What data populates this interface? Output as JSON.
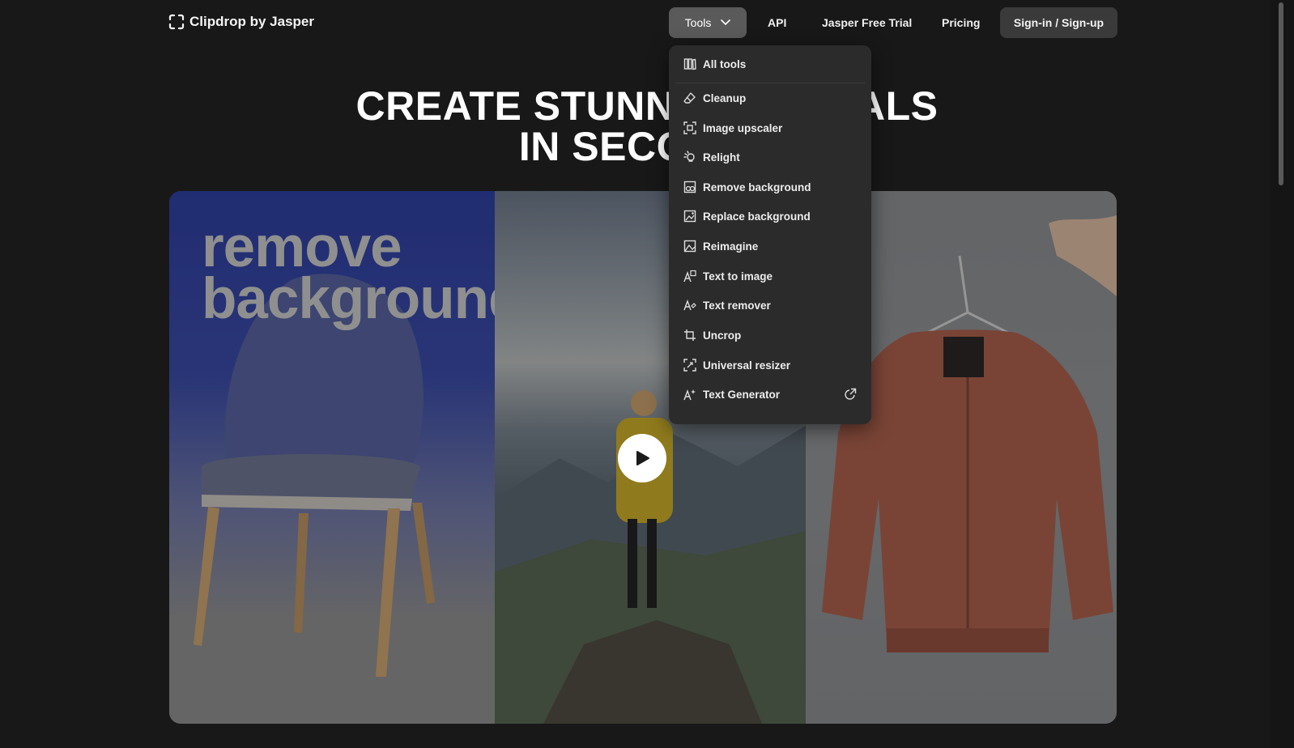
{
  "header": {
    "logo_text": "Clipdrop by Jasper",
    "nav": {
      "tools_label": "Tools",
      "api_label": "API",
      "trial_label": "Jasper Free Trial",
      "pricing_label": "Pricing",
      "signin_label": "Sign-in / Sign-up"
    }
  },
  "hero": {
    "title_line1": "CREATE STUNNING VISUALS",
    "title_line2": "IN SECONDS"
  },
  "banner": {
    "text_line1": "remove",
    "text_line2": "background"
  },
  "tools_menu": {
    "items": [
      {
        "label": "All tools",
        "icon": "all-tools-icon"
      },
      {
        "label": "Cleanup",
        "icon": "eraser-icon"
      },
      {
        "label": "Image upscaler",
        "icon": "upscale-icon"
      },
      {
        "label": "Relight",
        "icon": "bulb-icon"
      },
      {
        "label": "Remove background",
        "icon": "remove-bg-icon"
      },
      {
        "label": "Replace background",
        "icon": "replace-bg-icon"
      },
      {
        "label": "Reimagine",
        "icon": "reimagine-icon"
      },
      {
        "label": "Text to image",
        "icon": "text-to-image-icon"
      },
      {
        "label": "Text remover",
        "icon": "text-remover-icon"
      },
      {
        "label": "Uncrop",
        "icon": "uncrop-icon"
      },
      {
        "label": "Universal resizer",
        "icon": "resizer-icon"
      },
      {
        "label": "Text Generator",
        "icon": "text-generator-icon",
        "external": true
      }
    ]
  },
  "colors": {
    "page_bg": "#181818",
    "menu_bg": "#2b2b2b",
    "tools_button_bg": "#5a5a5a",
    "signin_bg": "#3a3a3a"
  }
}
